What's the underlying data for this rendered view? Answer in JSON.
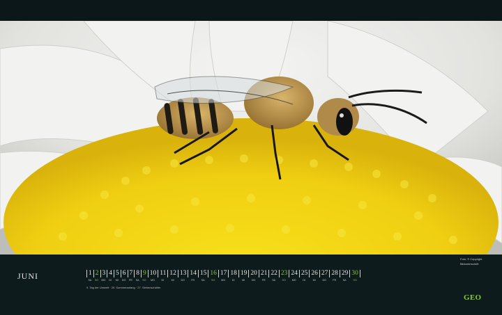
{
  "calendar": {
    "month": "JUNI",
    "days": [
      {
        "num": "1",
        "wd": "SA",
        "green": false
      },
      {
        "num": "2",
        "wd": "SO",
        "green": true
      },
      {
        "num": "3",
        "wd": "MO",
        "green": false
      },
      {
        "num": "4",
        "wd": "DI",
        "green": false
      },
      {
        "num": "5",
        "wd": "MI",
        "green": false
      },
      {
        "num": "6",
        "wd": "DO",
        "green": false
      },
      {
        "num": "7",
        "wd": "FR",
        "green": false
      },
      {
        "num": "8",
        "wd": "SA",
        "green": false
      },
      {
        "num": "9",
        "wd": "SO",
        "green": true
      },
      {
        "num": "10",
        "wd": "MO",
        "green": false
      },
      {
        "num": "11",
        "wd": "DI",
        "green": false
      },
      {
        "num": "12",
        "wd": "MI",
        "green": false
      },
      {
        "num": "13",
        "wd": "DO",
        "green": false
      },
      {
        "num": "14",
        "wd": "FR",
        "green": false
      },
      {
        "num": "15",
        "wd": "SA",
        "green": false
      },
      {
        "num": "16",
        "wd": "SO",
        "green": true
      },
      {
        "num": "17",
        "wd": "MO",
        "green": false
      },
      {
        "num": "18",
        "wd": "DI",
        "green": false
      },
      {
        "num": "19",
        "wd": "MI",
        "green": false
      },
      {
        "num": "20",
        "wd": "DO",
        "green": false
      },
      {
        "num": "21",
        "wd": "FR",
        "green": false
      },
      {
        "num": "22",
        "wd": "SA",
        "green": false
      },
      {
        "num": "23",
        "wd": "SO",
        "green": true
      },
      {
        "num": "24",
        "wd": "MO",
        "green": false
      },
      {
        "num": "25",
        "wd": "DI",
        "green": false
      },
      {
        "num": "26",
        "wd": "MI",
        "green": false
      },
      {
        "num": "27",
        "wd": "DO",
        "green": false
      },
      {
        "num": "28",
        "wd": "FR",
        "green": false
      },
      {
        "num": "29",
        "wd": "SA",
        "green": false
      },
      {
        "num": "30",
        "wd": "SO",
        "green": true
      }
    ],
    "holidays": "9. Tag der Umwelt · 20. Sommeranfang · 27. Siebenschläfer"
  },
  "credit": {
    "line1": "Foto: © Copyright",
    "line2": "Bildunterschrift"
  },
  "brand": {
    "logo": "GEO",
    "accent_color": "#8cc63f"
  }
}
